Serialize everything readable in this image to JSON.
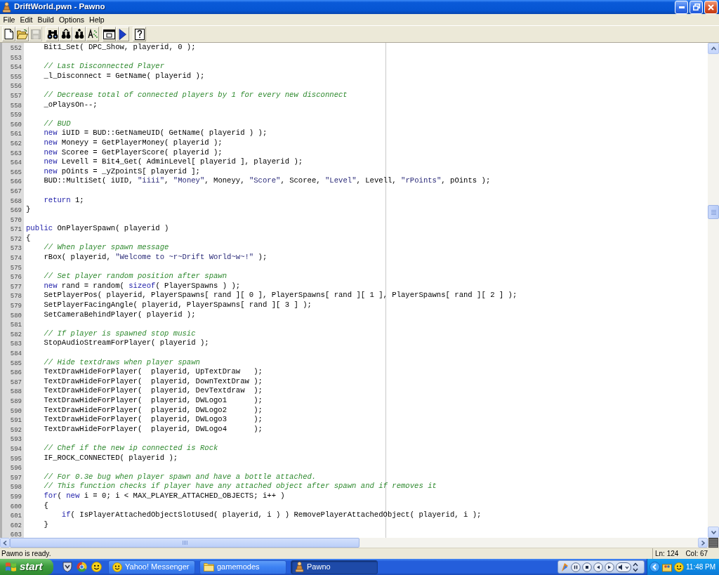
{
  "window": {
    "title": "DriftWorld.pwn - Pawno"
  },
  "menu": [
    "File",
    "Edit",
    "Build",
    "Options",
    "Help"
  ],
  "toolbar": [
    {
      "buttons": [
        {
          "kind": "new",
          "disabled": false
        },
        {
          "kind": "open",
          "disabled": false
        },
        {
          "kind": "save",
          "disabled": true
        }
      ]
    },
    {
      "buttons": [
        {
          "kind": "find",
          "disabled": false
        },
        {
          "kind": "find_next",
          "disabled": false
        },
        {
          "kind": "replace",
          "disabled": false
        },
        {
          "kind": "goto",
          "disabled": false
        }
      ]
    },
    {
      "buttons": [
        {
          "kind": "window",
          "disabled": false
        },
        {
          "kind": "compile",
          "disabled": false
        }
      ]
    },
    {
      "buttons": [
        {
          "kind": "help",
          "disabled": false
        }
      ]
    }
  ],
  "editor": {
    "lines": [
      {
        "children": [
          {
            "number": "552",
            "segments": [
              {
                "kind": "plain",
                "text": "Bit1_Set( DPC_Show, playerid, 0 );"
              }
            ]
          },
          {
            "number": "553"
          },
          {
            "number": "554",
            "segments": [
              {
                "kind": "comment",
                "text": "// Last Disconnected Player"
              }
            ]
          },
          {
            "number": "555",
            "segments": [
              {
                "kind": "plain",
                "text": "_l_Disconnect = GetName( playerid );"
              }
            ]
          },
          {
            "number": "556"
          },
          {
            "number": "557",
            "segments": [
              {
                "kind": "comment",
                "text": "// Decrease total of connected players by 1 for every new disconnect"
              }
            ]
          },
          {
            "number": "558",
            "segments": [
              {
                "kind": "plain",
                "text": "_oPlaysOn--;"
              }
            ]
          },
          {
            "number": "559"
          },
          {
            "number": "560",
            "segments": [
              {
                "kind": "comment",
                "text": "// BUD"
              }
            ]
          },
          {
            "number": "561",
            "segments": [
              {
                "kind": "keyword",
                "text": "new"
              },
              {
                "kind": "plain",
                "text": " iUID = BUD::GetNameUID( GetName( playerid ) );"
              }
            ]
          },
          {
            "number": "562",
            "segments": [
              {
                "kind": "keyword",
                "text": "new"
              },
              {
                "kind": "plain",
                "text": " Moneyy = GetPlayerMoney( playerid );"
              }
            ]
          },
          {
            "number": "563",
            "segments": [
              {
                "kind": "keyword",
                "text": "new"
              },
              {
                "kind": "plain",
                "text": " Scoree = GetPlayerScore( playerid );"
              }
            ]
          },
          {
            "number": "564",
            "segments": [
              {
                "kind": "keyword",
                "text": "new"
              },
              {
                "kind": "plain",
                "text": " Levell = Bit4_Get( AdminLevel[ playerid ], playerid );"
              }
            ]
          },
          {
            "number": "565",
            "segments": [
              {
                "kind": "keyword",
                "text": "new"
              },
              {
                "kind": "plain",
                "text": " pOints = _yZpointS[ playerid ];"
              }
            ]
          },
          {
            "number": "566",
            "segments": [
              {
                "kind": "plain",
                "text": "BUD::MultiSet( iUID, "
              },
              {
                "kind": "string",
                "text": "\"iiii\""
              },
              {
                "kind": "plain",
                "text": ", "
              },
              {
                "kind": "string",
                "text": "\"Money\""
              },
              {
                "kind": "plain",
                "text": ", Moneyy, "
              },
              {
                "kind": "string",
                "text": "\"Score\""
              },
              {
                "kind": "plain",
                "text": ", Scoree, "
              },
              {
                "kind": "string",
                "text": "\"Level\""
              },
              {
                "kind": "plain",
                "text": ", Levell, "
              },
              {
                "kind": "string",
                "text": "\"rPoints\""
              },
              {
                "kind": "plain",
                "text": ", pOints );"
              }
            ]
          },
          {
            "number": "567"
          },
          {
            "number": "568",
            "segments": [
              {
                "kind": "keyword",
                "text": "return"
              },
              {
                "kind": "plain",
                "text": " 1;"
              }
            ]
          }
        ]
      },
      {
        "number": "569",
        "segments": [
          {
            "kind": "plain",
            "text": "}"
          }
        ]
      },
      {
        "number": "570"
      },
      {
        "number": "571",
        "segments": [
          {
            "kind": "keyword",
            "text": "public"
          },
          {
            "kind": "plain",
            "text": " OnPlayerSpawn( playerid )"
          }
        ]
      },
      {
        "number": "572",
        "segments": [
          {
            "kind": "plain",
            "text": "{"
          }
        ]
      },
      {
        "children": [
          {
            "number": "573",
            "segments": [
              {
                "kind": "comment",
                "text": "// When player spawn message"
              }
            ]
          },
          {
            "number": "574",
            "segments": [
              {
                "kind": "plain",
                "text": "rBox( playerid, "
              },
              {
                "kind": "string",
                "text": "\"Welcome to ~r~Drift World~w~!\""
              },
              {
                "kind": "plain",
                "text": " );"
              }
            ]
          },
          {
            "number": "575"
          },
          {
            "number": "576",
            "segments": [
              {
                "kind": "comment",
                "text": "// Set player random position after spawn"
              }
            ]
          },
          {
            "number": "577",
            "segments": [
              {
                "kind": "keyword",
                "text": "new"
              },
              {
                "kind": "plain",
                "text": " rand = random( "
              },
              {
                "kind": "keyword",
                "text": "sizeof"
              },
              {
                "kind": "plain",
                "text": "( PlayerSpawns ) );"
              }
            ]
          },
          {
            "number": "578",
            "segments": [
              {
                "kind": "plain",
                "text": "SetPlayerPos( playerid, PlayerSpawns[ rand ][ 0 ], PlayerSpawns[ rand ][ 1 ], PlayerSpawns[ rand ][ 2 ] );"
              }
            ]
          },
          {
            "number": "579",
            "segments": [
              {
                "kind": "plain",
                "text": "SetPlayerFacingAngle( playerid, PlayerSpawns[ rand ][ 3 ] );"
              }
            ]
          },
          {
            "number": "580",
            "segments": [
              {
                "kind": "plain",
                "text": "SetCameraBehindPlayer( playerid );"
              }
            ]
          },
          {
            "number": "581"
          },
          {
            "number": "582",
            "segments": [
              {
                "kind": "comment",
                "text": "// If player is spawned stop music"
              }
            ]
          },
          {
            "number": "583",
            "segments": [
              {
                "kind": "plain",
                "text": "StopAudioStreamForPlayer( playerid );"
              }
            ]
          },
          {
            "number": "584"
          },
          {
            "number": "585",
            "segments": [
              {
                "kind": "comment",
                "text": "// Hide textdraws when player spawn"
              }
            ]
          },
          {
            "number": "586",
            "segments": [
              {
                "kind": "plain",
                "text": "TextDrawHideForPlayer(  playerid, UpTextDraw   );"
              }
            ]
          },
          {
            "number": "587",
            "segments": [
              {
                "kind": "plain",
                "text": "TextDrawHideForPlayer(  playerid, DownTextDraw );"
              }
            ]
          },
          {
            "number": "588",
            "segments": [
              {
                "kind": "plain",
                "text": "TextDrawHideForPlayer(  playerid, DevTextdraw  );"
              }
            ]
          },
          {
            "number": "589",
            "segments": [
              {
                "kind": "plain",
                "text": "TextDrawHideForPlayer(  playerid, DWLogo1      );"
              }
            ]
          },
          {
            "number": "590",
            "segments": [
              {
                "kind": "plain",
                "text": "TextDrawHideForPlayer(  playerid, DWLogo2      );"
              }
            ]
          },
          {
            "number": "591",
            "segments": [
              {
                "kind": "plain",
                "text": "TextDrawHideForPlayer(  playerid, DWLogo3      );"
              }
            ]
          },
          {
            "number": "592",
            "segments": [
              {
                "kind": "plain",
                "text": "TextDrawHideForPlayer(  playerid, DWLogo4      );"
              }
            ]
          },
          {
            "number": "593"
          },
          {
            "number": "594",
            "segments": [
              {
                "kind": "comment",
                "text": "// Chef if the new ip connected is Rock"
              }
            ]
          },
          {
            "number": "595",
            "segments": [
              {
                "kind": "plain",
                "text": "IF_ROCK_CONNECTED( playerid );"
              }
            ]
          },
          {
            "number": "596"
          },
          {
            "number": "597",
            "segments": [
              {
                "kind": "comment",
                "text": "// For 0.3e bug when player spawn and have a bottle attached."
              }
            ]
          },
          {
            "number": "598",
            "segments": [
              {
                "kind": "comment",
                "text": "// This function checks if player have any attached object after spawn and if removes it"
              }
            ]
          },
          {
            "number": "599",
            "segments": [
              {
                "kind": "keyword",
                "text": "for"
              },
              {
                "kind": "plain",
                "text": "( "
              },
              {
                "kind": "keyword",
                "text": "new"
              },
              {
                "kind": "plain",
                "text": " i = 0; i < MAX_PLAYER_ATTACHED_OBJECTS; i++ )"
              }
            ]
          },
          {
            "number": "600",
            "segments": [
              {
                "kind": "plain",
                "text": "{"
              }
            ]
          },
          {
            "children": [
              {
                "number": "601",
                "segments": [
                  {
                    "kind": "keyword",
                    "text": "if"
                  },
                  {
                    "kind": "plain",
                    "text": "( IsPlayerAttachedObjectSlotUsed( playerid, i ) ) RemovePlayerAttachedObject( playerid, i );"
                  }
                ]
              }
            ]
          },
          {
            "number": "602",
            "segments": [
              {
                "kind": "plain",
                "text": "}"
              }
            ]
          }
        ]
      },
      {
        "number": "603"
      }
    ]
  },
  "status_bar": {
    "message": "Pawno is ready.",
    "line": "Ln: 124",
    "column": "Col: 67"
  },
  "taskbar": {
    "start": "start",
    "tasks": [
      {
        "kind": "messenger",
        "label": "Yahoo! Messenger",
        "selected": false
      },
      {
        "kind": "folder",
        "label": "gamemodes",
        "selected": false
      },
      {
        "kind": "pawno",
        "label": "Pawno",
        "selected": true
      }
    ],
    "clock": "11:48 PM"
  }
}
